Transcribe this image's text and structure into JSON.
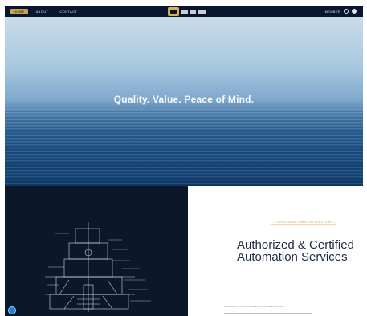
{
  "nav": {
    "items": [
      "HOME",
      "ABOUT",
      "CONTACT"
    ],
    "right_label": "MEMBER"
  },
  "hero": {
    "title": "Quality. Value. Peace of Mind."
  },
  "section": {
    "eyebrow": "— OFFICIAL AUTOMATION SOLUTIONS —",
    "headline": "Authorized & Certified Automation Services",
    "subtext": "We ensure the highest standards in automation services"
  },
  "colors": {
    "nav_bg": "#0a1530",
    "accent_gold": "#c7a24d",
    "dark_panel": "#0c1729",
    "headline": "#1b2a4a"
  },
  "icons": {
    "logo": "brand-logo-icon",
    "account": "user-icon",
    "menu": "menu-icon",
    "help": "help-icon"
  }
}
